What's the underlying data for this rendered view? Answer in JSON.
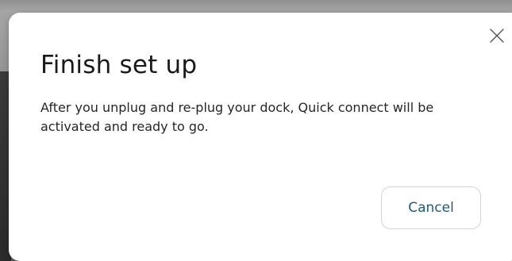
{
  "dialog": {
    "title": "Finish set up",
    "message": "After you unplug and re-plug your dock, Quick connect will be activated and ready to go.",
    "cancel_label": "Cancel",
    "close_icon": "close-icon"
  },
  "colors": {
    "dialog_background": "#ffffff",
    "title_text": "#1a1a1a",
    "body_text": "#262626",
    "cancel_text": "#1f5a7a",
    "cancel_border": "#cfd4d8"
  }
}
